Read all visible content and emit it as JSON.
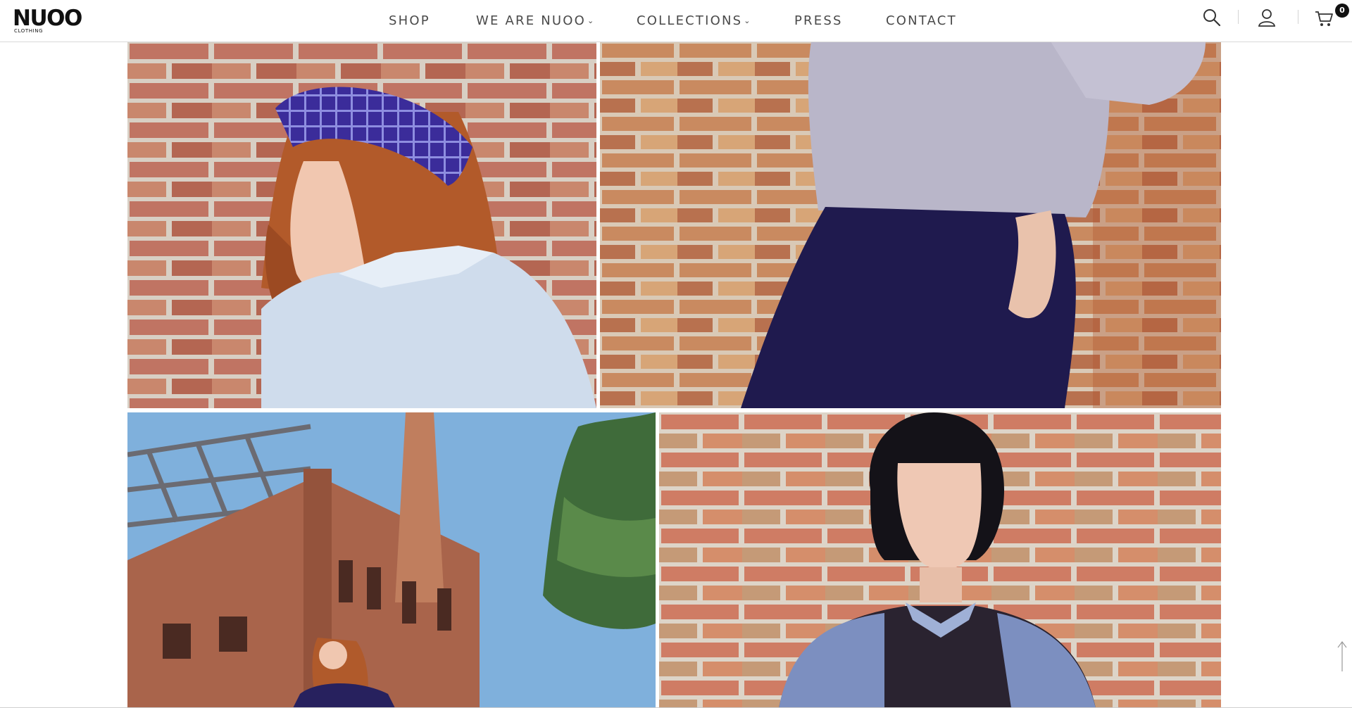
{
  "header": {
    "logo": {
      "wordmark": "NUOO",
      "sub": "CLOTHING"
    },
    "nav": [
      {
        "label": "SHOP",
        "has_dropdown": false
      },
      {
        "label": "WE ARE NUOO",
        "has_dropdown": true
      },
      {
        "label": "COLLECTIONS",
        "has_dropdown": true
      },
      {
        "label": "PRESS",
        "has_dropdown": false
      },
      {
        "label": "CONTACT",
        "has_dropdown": false
      }
    ],
    "icons": [
      "search-icon",
      "user-icon",
      "cart-icon"
    ],
    "cart_count": "0"
  },
  "gallery": [
    {
      "name": "photo-headband",
      "subject": "red-haired model in purple plaid headband and light blue shirt against brick wall"
    },
    {
      "name": "photo-skirt",
      "subject": "model in lavender top and navy skirt leaning on brick wall"
    },
    {
      "name": "photo-factory",
      "subject": "model in navy coat in front of brick factory with chimney and blue sky"
    },
    {
      "name": "photo-bob",
      "subject": "model with black bob haircut in blue and black shirt against brick wall"
    }
  ],
  "colors": {
    "brick": "#b86a55",
    "navy": "#2a2460",
    "sky": "#7fb0dc",
    "nav_text": "#4a4a4a"
  }
}
